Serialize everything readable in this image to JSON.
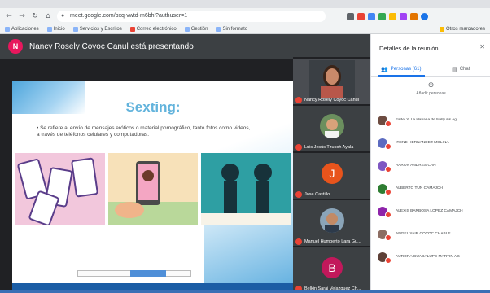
{
  "browser": {
    "url": "meet.google.com/bxq-vwtd-m6bhl?authuser=1",
    "bookmarks": [
      "Aplicaciones",
      "Inicio",
      "Servicios y Escritos",
      "Correo electrónico",
      "Gestión",
      "Sin formato",
      "Otros marcadores"
    ]
  },
  "meet": {
    "presenter_initial": "N",
    "presenter_text": "Nancy Rosely Coyoc Canul está presentando"
  },
  "slide": {
    "title": "Sexting:",
    "bullet": "Se refiere al envío de mensajes eróticos o material pornográfico, tanto fotos como videos, a través de teléfonos celulares y computadoras."
  },
  "tiles": [
    {
      "name": "Nancy Rosely Coyoc Canul",
      "type": "photo",
      "color": "#8a5a44"
    },
    {
      "name": "Luis Jesús Tzucoh Ayala",
      "type": "photo",
      "color": "#6b8f5e"
    },
    {
      "name": "Jose Castillo",
      "type": "letter",
      "letter": "J",
      "color": "#e8541c"
    },
    {
      "name": "Manuel Humberto Lara Gu...",
      "type": "photo",
      "color": "#9b7a63"
    },
    {
      "name": "Belkin Sarai Velazquez Ch...",
      "type": "letter",
      "letter": "B",
      "color": "#c2185b"
    }
  ],
  "panel": {
    "title": "Detalles de la reunión",
    "tab_people": "Personas (61)",
    "tab_chat": "Chat",
    "add_people": "Añadir personas",
    "participants": [
      {
        "name": "Fadel Yi La Habana de Nelly sis Ag",
        "color": "#6d4c41"
      },
      {
        "name": "IRENE HERNÁNDEZ MOLINA",
        "color": "#5c6bc0"
      },
      {
        "name": "AARON ANDRES CAN",
        "color": "#7e57c2"
      },
      {
        "name": "ALBERTO TUN CAMAJCH",
        "color": "#2e7d32"
      },
      {
        "name": "ALEXIS BARBOSA LOPEZ CAMAJCH",
        "color": "#8e24aa"
      },
      {
        "name": "ANGEL YAIR COYOC CHABLE",
        "color": "#8d6e63"
      },
      {
        "name": "AURORA GUADALUPE MARTIN AG",
        "color": "#5d4037"
      }
    ]
  }
}
